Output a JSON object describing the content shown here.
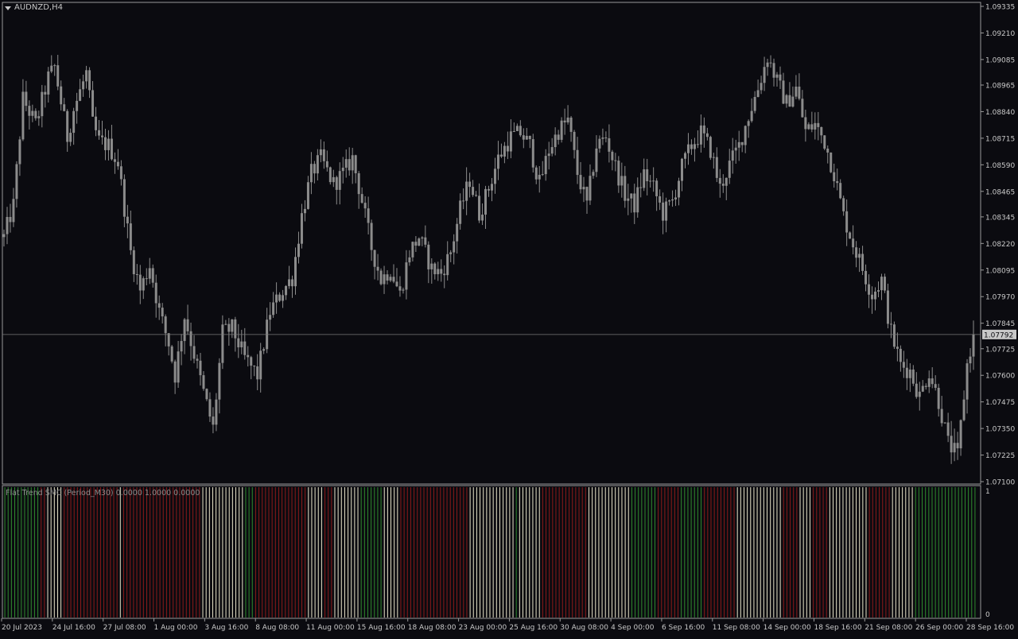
{
  "header": {
    "symbol_label": "AUDNZD,H4"
  },
  "price_tag": "1.07792",
  "indicator": {
    "label": "Flat Trend SMC (Period_M30) 0.0000 1.0000 0.0000",
    "y_ticks": [
      "1",
      "0"
    ]
  },
  "colors": {
    "background": "#0b0b10",
    "candle": "#8c8c8c",
    "indicator_green": "#2e8b2e",
    "indicator_red": "#8b1a1a",
    "indicator_white": "#e8e4c8"
  },
  "chart_data": [
    {
      "type": "candlestick",
      "title": "AUDNZD,H4",
      "ylim": [
        1.071,
        1.09335
      ],
      "y_ticks": [
        "1.09335",
        "1.09210",
        "1.09085",
        "1.08965",
        "1.08840",
        "1.08715",
        "1.08590",
        "1.08465",
        "1.08345",
        "1.08220",
        "1.08095",
        "1.07970",
        "1.07845",
        "1.07725",
        "1.07600",
        "1.07475",
        "1.07350",
        "1.07225",
        "1.07100"
      ],
      "x_ticks": [
        "20 Jul 2023",
        "24 Jul 16:00",
        "27 Jul 08:00",
        "1 Aug 00:00",
        "3 Aug 16:00",
        "8 Aug 08:00",
        "11 Aug 00:00",
        "15 Aug 16:00",
        "18 Aug 08:00",
        "23 Aug 00:00",
        "25 Aug 16:00",
        "30 Aug 08:00",
        "4 Sep 00:00",
        "6 Sep 16:00",
        "11 Sep 08:00",
        "14 Sep 00:00",
        "18 Sep 16:00",
        "21 Sep 08:00",
        "26 Sep 00:00",
        "28 Sep 16:00"
      ],
      "current_price": 1.07792,
      "close_path": [
        [
          0,
          1.0825
        ],
        [
          3,
          1.084
        ],
        [
          6,
          1.089
        ],
        [
          10,
          1.0878
        ],
        [
          14,
          1.09
        ],
        [
          16,
          1.0905
        ],
        [
          20,
          1.0872
        ],
        [
          22,
          1.0885
        ],
        [
          26,
          1.0902
        ],
        [
          28,
          1.0878
        ],
        [
          30,
          1.087
        ],
        [
          33,
          1.0868
        ],
        [
          36,
          1.086
        ],
        [
          40,
          1.0818
        ],
        [
          43,
          1.08
        ],
        [
          46,
          1.0812
        ],
        [
          49,
          1.079
        ],
        [
          52,
          1.0775
        ],
        [
          54,
          1.076
        ],
        [
          57,
          1.0788
        ],
        [
          60,
          1.077
        ],
        [
          63,
          1.0752
        ],
        [
          66,
          1.0735
        ],
        [
          69,
          1.078
        ],
        [
          72,
          1.0782
        ],
        [
          76,
          1.0768
        ],
        [
          80,
          1.076
        ],
        [
          84,
          1.079
        ],
        [
          88,
          1.08
        ],
        [
          91,
          1.0806
        ],
        [
          94,
          1.0835
        ],
        [
          97,
          1.0855
        ],
        [
          100,
          1.0862
        ],
        [
          104,
          1.085
        ],
        [
          107,
          1.0855
        ],
        [
          110,
          1.0862
        ],
        [
          113,
          1.0842
        ],
        [
          116,
          1.082
        ],
        [
          119,
          1.0805
        ],
        [
          122,
          1.081
        ],
        [
          125,
          1.0798
        ],
        [
          128,
          1.0818
        ],
        [
          131,
          1.0825
        ],
        [
          135,
          1.081
        ],
        [
          138,
          1.0808
        ],
        [
          141,
          1.0818
        ],
        [
          144,
          1.0838
        ],
        [
          147,
          1.0852
        ],
        [
          150,
          1.0836
        ],
        [
          153,
          1.0848
        ],
        [
          156,
          1.0862
        ],
        [
          160,
          1.0872
        ],
        [
          163,
          1.0874
        ],
        [
          166,
          1.0868
        ],
        [
          169,
          1.085
        ],
        [
          172,
          1.0866
        ],
        [
          175,
          1.0875
        ],
        [
          178,
          1.088
        ],
        [
          181,
          1.0855
        ],
        [
          184,
          1.084
        ],
        [
          187,
          1.0868
        ],
        [
          190,
          1.0872
        ],
        [
          193,
          1.0858
        ],
        [
          196,
          1.0845
        ],
        [
          199,
          1.084
        ],
        [
          202,
          1.0855
        ],
        [
          205,
          1.0848
        ],
        [
          208,
          1.0836
        ],
        [
          211,
          1.0842
        ],
        [
          214,
          1.0858
        ],
        [
          217,
          1.0868
        ],
        [
          220,
          1.0874
        ],
        [
          223,
          1.0866
        ],
        [
          226,
          1.0848
        ],
        [
          229,
          1.0859
        ],
        [
          232,
          1.0868
        ],
        [
          235,
          1.0882
        ],
        [
          238,
          1.0895
        ],
        [
          241,
          1.091
        ],
        [
          244,
          1.0898
        ],
        [
          247,
          1.0888
        ],
        [
          250,
          1.0895
        ],
        [
          253,
          1.0875
        ],
        [
          256,
          1.0878
        ],
        [
          259,
          1.087
        ],
        [
          262,
          1.0855
        ],
        [
          265,
          1.0835
        ],
        [
          268,
          1.0822
        ],
        [
          271,
          1.081
        ],
        [
          274,
          1.0798
        ],
        [
          277,
          1.0805
        ],
        [
          280,
          1.078
        ],
        [
          283,
          1.0765
        ],
        [
          286,
          1.0762
        ],
        [
          289,
          1.075
        ],
        [
          292,
          1.0762
        ],
        [
          295,
          1.0748
        ],
        [
          298,
          1.0728
        ],
        [
          301,
          1.0722
        ],
        [
          304,
          1.0765
        ],
        [
          306,
          1.0779
        ]
      ]
    },
    {
      "type": "bar",
      "title": "Flat Trend SMC (Period_M30) 0.0000 1.0000 0.0000",
      "ylim": [
        0,
        1
      ],
      "segments": [
        {
          "color": "green",
          "bars": 11
        },
        {
          "color": "red",
          "bars": 2
        },
        {
          "color": "white",
          "bars": 5
        },
        {
          "color": "red",
          "bars": 17
        },
        {
          "color": "white",
          "bars": 1
        },
        {
          "color": "red",
          "bars": 24
        },
        {
          "color": "white",
          "bars": 13
        },
        {
          "color": "green",
          "bars": 3
        },
        {
          "color": "red",
          "bars": 16
        },
        {
          "color": "white",
          "bars": 5
        },
        {
          "color": "red",
          "bars": 3
        },
        {
          "color": "white",
          "bars": 8
        },
        {
          "color": "green",
          "bars": 7
        },
        {
          "color": "white",
          "bars": 5
        },
        {
          "color": "red",
          "bars": 21
        },
        {
          "color": "white",
          "bars": 14
        },
        {
          "color": "green",
          "bars": 1
        },
        {
          "color": "white",
          "bars": 7
        },
        {
          "color": "red",
          "bars": 14
        },
        {
          "color": "white",
          "bars": 13
        },
        {
          "color": "green",
          "bars": 8
        },
        {
          "color": "red",
          "bars": 7
        },
        {
          "color": "green",
          "bars": 7
        },
        {
          "color": "red",
          "bars": 10
        },
        {
          "color": "white",
          "bars": 14
        },
        {
          "color": "red",
          "bars": 5
        },
        {
          "color": "white",
          "bars": 4
        },
        {
          "color": "red",
          "bars": 5
        },
        {
          "color": "white",
          "bars": 12
        },
        {
          "color": "red",
          "bars": 7
        },
        {
          "color": "white",
          "bars": 7
        },
        {
          "color": "green",
          "bars": 19
        }
      ]
    }
  ]
}
